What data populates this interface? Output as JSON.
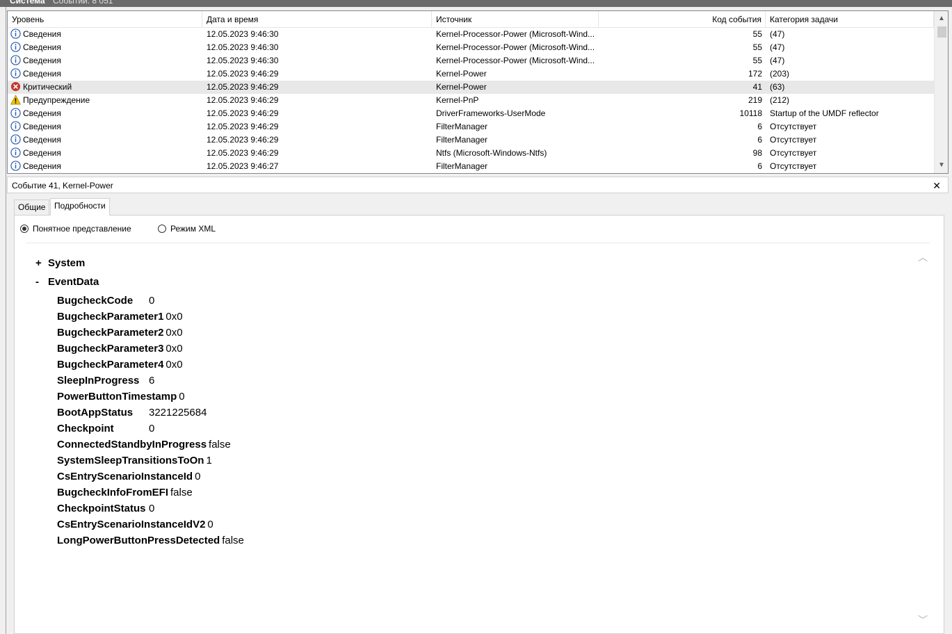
{
  "window": {
    "title": "Система",
    "count_label": "Событий: 8 051"
  },
  "list": {
    "columns": {
      "level": "Уровень",
      "datetime": "Дата и время",
      "source": "Источник",
      "event_id": "Код события",
      "category": "Категория задачи"
    },
    "rows": [
      {
        "icon": "info-icon",
        "level": "Сведения",
        "datetime": "12.05.2023 9:46:30",
        "source": "Kernel-Processor-Power (Microsoft-Wind...",
        "event_id": "55",
        "category": "(47)"
      },
      {
        "icon": "info-icon",
        "level": "Сведения",
        "datetime": "12.05.2023 9:46:30",
        "source": "Kernel-Processor-Power (Microsoft-Wind...",
        "event_id": "55",
        "category": "(47)"
      },
      {
        "icon": "info-icon",
        "level": "Сведения",
        "datetime": "12.05.2023 9:46:30",
        "source": "Kernel-Processor-Power (Microsoft-Wind...",
        "event_id": "55",
        "category": "(47)"
      },
      {
        "icon": "info-icon",
        "level": "Сведения",
        "datetime": "12.05.2023 9:46:29",
        "source": "Kernel-Power",
        "event_id": "172",
        "category": "(203)"
      },
      {
        "icon": "error-icon",
        "level": "Критический",
        "datetime": "12.05.2023 9:46:29",
        "source": "Kernel-Power",
        "event_id": "41",
        "category": "(63)",
        "selected": true
      },
      {
        "icon": "warning-icon",
        "level": "Предупреждение",
        "datetime": "12.05.2023 9:46:29",
        "source": "Kernel-PnP",
        "event_id": "219",
        "category": "(212)"
      },
      {
        "icon": "info-icon",
        "level": "Сведения",
        "datetime": "12.05.2023 9:46:29",
        "source": "DriverFrameworks-UserMode",
        "event_id": "10118",
        "category": "Startup of the UMDF reflector"
      },
      {
        "icon": "info-icon",
        "level": "Сведения",
        "datetime": "12.05.2023 9:46:29",
        "source": "FilterManager",
        "event_id": "6",
        "category": "Отсутствует"
      },
      {
        "icon": "info-icon",
        "level": "Сведения",
        "datetime": "12.05.2023 9:46:29",
        "source": "FilterManager",
        "event_id": "6",
        "category": "Отсутствует"
      },
      {
        "icon": "info-icon",
        "level": "Сведения",
        "datetime": "12.05.2023 9:46:29",
        "source": "Ntfs (Microsoft-Windows-Ntfs)",
        "event_id": "98",
        "category": "Отсутствует"
      },
      {
        "icon": "info-icon",
        "level": "Сведения",
        "datetime": "12.05.2023 9:46:27",
        "source": "FilterManager",
        "event_id": "6",
        "category": "Отсутствует"
      }
    ]
  },
  "detail": {
    "title": "Событие 41, Kernel-Power",
    "close": "✕",
    "tabs": [
      {
        "label": "Общие"
      },
      {
        "label": "Подробности",
        "active": true
      }
    ],
    "radio_friendly": "Понятное представление",
    "radio_xml": "Режим XML",
    "selected_view": "friendly",
    "system_sign": "+",
    "system_label": "System",
    "eventdata_sign": "-",
    "eventdata_label": "EventData",
    "fields": [
      {
        "key": "BugcheckCode",
        "value": "0"
      },
      {
        "key": "BugcheckParameter1",
        "value": "0x0"
      },
      {
        "key": "BugcheckParameter2",
        "value": "0x0"
      },
      {
        "key": "BugcheckParameter3",
        "value": "0x0"
      },
      {
        "key": "BugcheckParameter4",
        "value": "0x0"
      },
      {
        "key": "SleepInProgress",
        "value": "6"
      },
      {
        "key": "PowerButtonTimestamp",
        "value": "0"
      },
      {
        "key": "BootAppStatus",
        "value": "3221225684"
      },
      {
        "key": "Checkpoint",
        "value": "0"
      },
      {
        "key": "ConnectedStandbyInProgress",
        "value": "false"
      },
      {
        "key": "SystemSleepTransitionsToOn",
        "value": "1"
      },
      {
        "key": "CsEntryScenarioInstanceId",
        "value": "0"
      },
      {
        "key": "BugcheckInfoFromEFI",
        "value": "false"
      },
      {
        "key": "CheckpointStatus",
        "value": "0"
      },
      {
        "key": "CsEntryScenarioInstanceIdV2",
        "value": "0"
      },
      {
        "key": "LongPowerButtonPressDetected",
        "value": "false"
      }
    ]
  },
  "colors": {
    "info": "#2a5db0",
    "error": "#c0392b",
    "warning": "#f2c200",
    "selected_row": "#e8e8e8"
  }
}
